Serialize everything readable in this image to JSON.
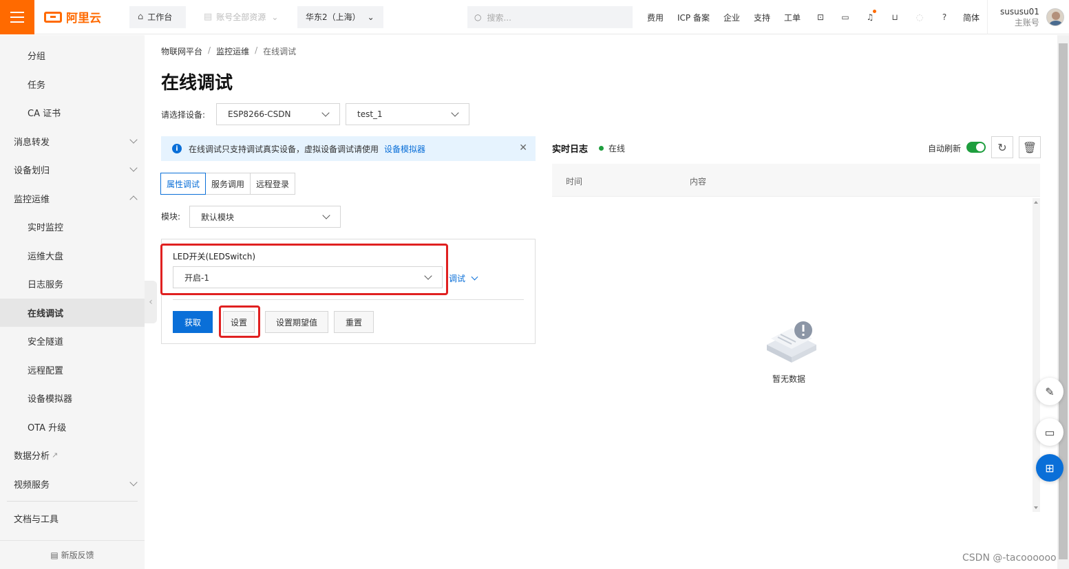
{
  "topbar": {
    "logo": "阿里云",
    "workbench": "工作台",
    "resources": "账号全部资源",
    "region": "华东2（上海）",
    "search_placeholder": "搜索...",
    "links": [
      "费用",
      "ICP 备案",
      "企业",
      "支持",
      "工单"
    ],
    "lang": "简体",
    "user_name": "sususu01",
    "user_role": "主账号"
  },
  "sidebar": {
    "items": [
      {
        "label": "分组",
        "level": "sub"
      },
      {
        "label": "任务",
        "level": "sub"
      },
      {
        "label": "CA 证书",
        "level": "sub"
      },
      {
        "label": "消息转发",
        "level": "top",
        "chevron": "down"
      },
      {
        "label": "设备划归",
        "level": "top",
        "chevron": "down"
      },
      {
        "label": "监控运维",
        "level": "top",
        "chevron": "up"
      },
      {
        "label": "实时监控",
        "level": "sub"
      },
      {
        "label": "运维大盘",
        "level": "sub"
      },
      {
        "label": "日志服务",
        "level": "sub"
      },
      {
        "label": "在线调试",
        "level": "sub",
        "active": true
      },
      {
        "label": "安全隧道",
        "level": "sub"
      },
      {
        "label": "远程配置",
        "level": "sub"
      },
      {
        "label": "设备模拟器",
        "level": "sub"
      },
      {
        "label": "OTA 升级",
        "level": "sub"
      },
      {
        "label": "数据分析",
        "level": "top",
        "external": true
      },
      {
        "label": "视频服务",
        "level": "top",
        "chevron": "down"
      }
    ],
    "docs": "文档与工具",
    "feedback": "新版反馈"
  },
  "breadcrumb": [
    "物联网平台",
    "监控运维",
    "在线调试"
  ],
  "page_title": "在线调试",
  "device_label": "请选择设备:",
  "product_select": "ESP8266-CSDN",
  "device_select": "test_1",
  "notice": {
    "text": "在线调试只支持调试真实设备，虚拟设备调试请使用",
    "link": "设备模拟器"
  },
  "tabs": [
    "属性调试",
    "服务调用",
    "远程登录"
  ],
  "module_label": "模块:",
  "module_select": "默认模块",
  "property": {
    "label": "LED开关(LEDSwitch)",
    "value": "开启-1"
  },
  "debug_link": "调试",
  "buttons": {
    "get": "获取",
    "set": "设置",
    "set_expected": "设置期望值",
    "reset": "重置"
  },
  "log": {
    "title": "实时日志",
    "status": "在线",
    "auto_refresh": "自动刷新",
    "columns": [
      "时间",
      "内容"
    ],
    "empty": "暂无数据"
  },
  "watermark": "CSDN @-tacoooooo",
  "colors": {
    "brand": "#ff6a00",
    "primary": "#0a6fd8",
    "online": "#1e9e3e",
    "highlight": "#e02020"
  }
}
